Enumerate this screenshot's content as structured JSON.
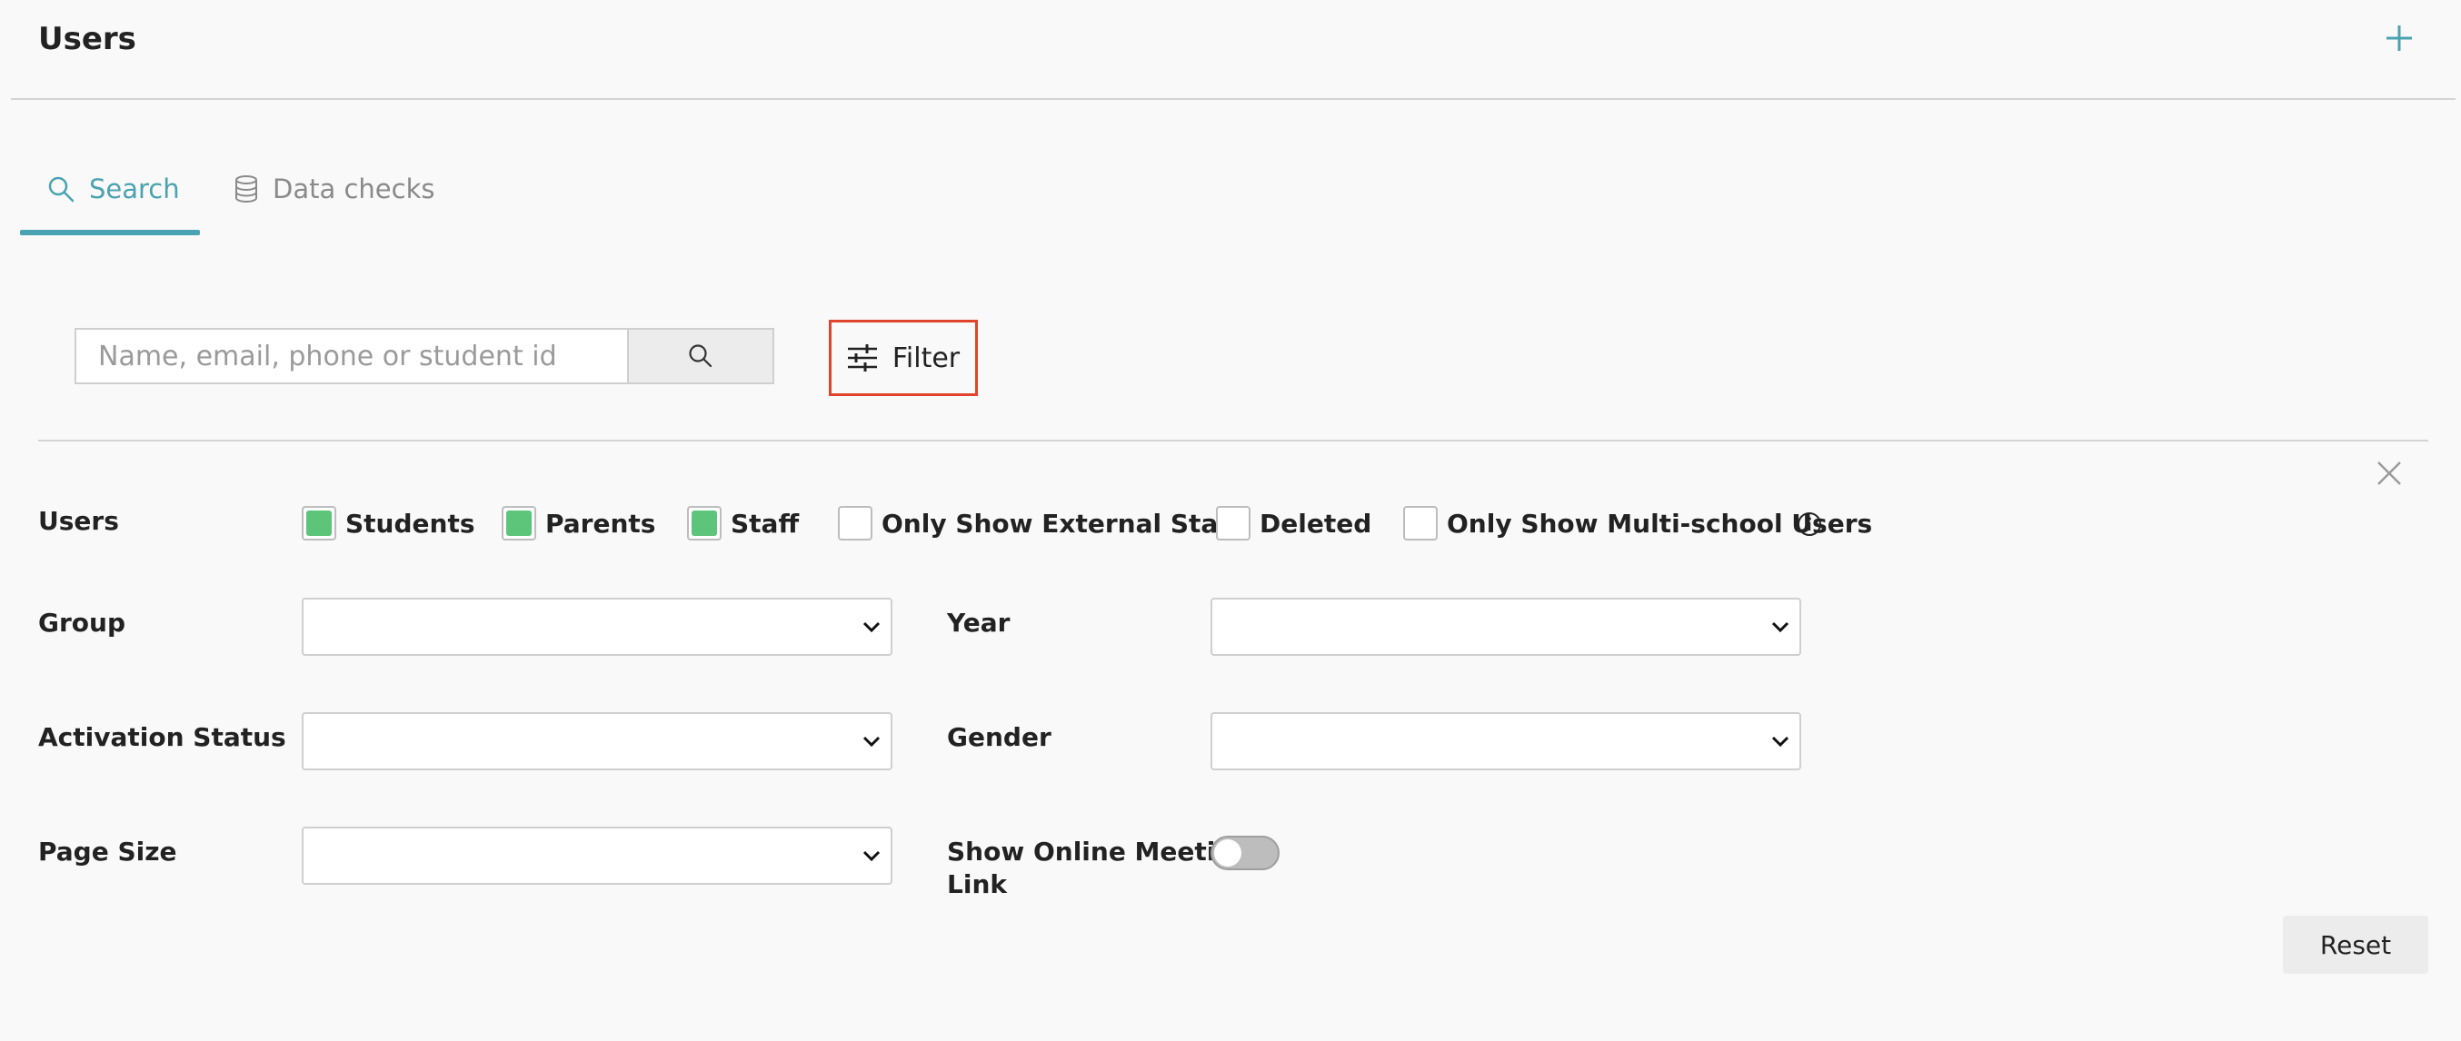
{
  "header": {
    "title": "Users",
    "add_icon": "plus-icon"
  },
  "tabs": [
    {
      "label": "Search",
      "icon": "search-icon",
      "active": true
    },
    {
      "label": "Data checks",
      "icon": "database-icon",
      "active": false
    }
  ],
  "search": {
    "placeholder": "Name, email, phone or student id",
    "value": ""
  },
  "filter_button": {
    "label": "Filter",
    "icon": "sliders-icon"
  },
  "filters": {
    "users_label": "Users",
    "checkboxes": [
      {
        "label": "Students",
        "checked": true
      },
      {
        "label": "Parents",
        "checked": true
      },
      {
        "label": "Staff",
        "checked": true
      },
      {
        "label": "Only Show External Staff",
        "checked": false
      },
      {
        "label": "Deleted",
        "checked": false
      },
      {
        "label": "Only Show Multi-school Users",
        "checked": false
      }
    ],
    "group_label": "Group",
    "year_label": "Year",
    "activation_label": "Activation Status",
    "gender_label": "Gender",
    "page_size_label": "Page Size",
    "online_meeting_label_line1": "Show Online Meeting",
    "online_meeting_label_line2": "Link",
    "online_meeting_enabled": false,
    "reset_label": "Reset"
  },
  "colors": {
    "accent": "#4aa3b0",
    "checked": "#5cc57a",
    "highlight_border": "#e0442b"
  }
}
